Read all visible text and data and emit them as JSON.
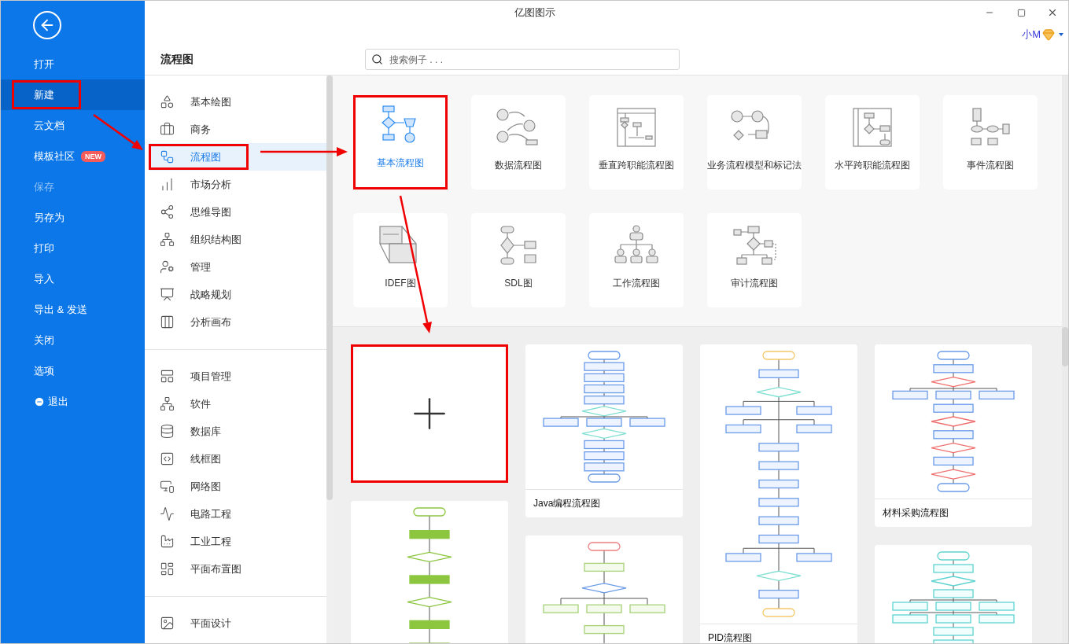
{
  "window": {
    "title": "亿图图示",
    "user": "小M"
  },
  "sidebar": [
    {
      "label": "打开",
      "kind": "command",
      "selected": false,
      "disabled": false,
      "highlighted": false
    },
    {
      "label": "新建",
      "kind": "command",
      "selected": true,
      "disabled": false,
      "highlighted": true
    },
    {
      "label": "云文档",
      "kind": "command",
      "selected": false,
      "disabled": false,
      "highlighted": false
    },
    {
      "label": "模板社区",
      "kind": "command",
      "badge": "NEW",
      "selected": false,
      "disabled": false,
      "highlighted": false
    },
    {
      "label": "保存",
      "kind": "command",
      "selected": false,
      "disabled": true,
      "highlighted": false
    },
    {
      "label": "另存为",
      "kind": "command",
      "selected": false,
      "disabled": false,
      "highlighted": false
    },
    {
      "label": "打印",
      "kind": "command",
      "selected": false,
      "disabled": false,
      "highlighted": false
    },
    {
      "label": "导入",
      "kind": "command",
      "selected": false,
      "disabled": false,
      "highlighted": false
    },
    {
      "label": "导出 & 发送",
      "kind": "command",
      "selected": false,
      "disabled": false,
      "highlighted": false
    },
    {
      "label": "关闭",
      "kind": "command",
      "selected": false,
      "disabled": false,
      "highlighted": false
    },
    {
      "label": "选项",
      "kind": "command",
      "selected": false,
      "disabled": false,
      "highlighted": false
    },
    {
      "label": "退出",
      "kind": "exit",
      "selected": false,
      "disabled": false,
      "highlighted": false
    }
  ],
  "header": {
    "title": "流程图",
    "search": {
      "placeholder": "搜索例子 . . ."
    }
  },
  "category_groups": [
    [
      {
        "label": "基本绘图",
        "selected": false,
        "highlighted": false
      },
      {
        "label": "商务",
        "selected": false,
        "highlighted": false
      },
      {
        "label": "流程图",
        "selected": true,
        "highlighted": true
      },
      {
        "label": "市场分析",
        "selected": false,
        "highlighted": false
      },
      {
        "label": "思维导图",
        "selected": false,
        "highlighted": false
      },
      {
        "label": "组织结构图",
        "selected": false,
        "highlighted": false
      },
      {
        "label": "管理",
        "selected": false,
        "highlighted": false
      },
      {
        "label": "战略规划",
        "selected": false,
        "highlighted": false
      },
      {
        "label": "分析画布",
        "selected": false,
        "highlighted": false
      }
    ],
    [
      {
        "label": "项目管理",
        "selected": false,
        "highlighted": false
      },
      {
        "label": "软件",
        "selected": false,
        "highlighted": false
      },
      {
        "label": "数据库",
        "selected": false,
        "highlighted": false
      },
      {
        "label": "线框图",
        "selected": false,
        "highlighted": false
      },
      {
        "label": "网络图",
        "selected": false,
        "highlighted": false
      },
      {
        "label": "电路工程",
        "selected": false,
        "highlighted": false
      },
      {
        "label": "工业工程",
        "selected": false,
        "highlighted": false
      },
      {
        "label": "平面布置图",
        "selected": false,
        "highlighted": false
      }
    ],
    [
      {
        "label": "平面设计",
        "selected": false,
        "highlighted": false
      }
    ]
  ],
  "diagram_types": [
    {
      "label": "基本流程图",
      "selected": true,
      "highlighted": true
    },
    {
      "label": "数据流程图",
      "selected": false,
      "highlighted": false
    },
    {
      "label": "垂直跨职能流程图",
      "selected": false,
      "highlighted": false
    },
    {
      "label": "业务流程模型和标记法",
      "selected": false,
      "highlighted": false
    },
    {
      "label": "水平跨职能流程图",
      "selected": false,
      "highlighted": false
    },
    {
      "label": "事件流程图",
      "selected": false,
      "highlighted": false
    },
    {
      "label": "IDEF图",
      "selected": false,
      "highlighted": false
    },
    {
      "label": "SDL图",
      "selected": false,
      "highlighted": false
    },
    {
      "label": "工作流程图",
      "selected": false,
      "highlighted": false
    },
    {
      "label": "审计流程图",
      "selected": false,
      "highlighted": false
    }
  ],
  "template_columns": [
    [
      {
        "kind": "blank",
        "highlighted": true
      },
      {
        "kind": "preview",
        "highlighted": false
      }
    ],
    [
      {
        "kind": "preview",
        "caption": "Java编程流程图",
        "highlighted": false
      },
      {
        "kind": "preview",
        "highlighted": false
      }
    ],
    [
      {
        "kind": "preview",
        "caption": "PID流程图",
        "highlighted": false
      }
    ],
    [
      {
        "kind": "preview",
        "caption": "材料采购流程图",
        "highlighted": false
      },
      {
        "kind": "preview",
        "highlighted": false
      }
    ]
  ]
}
